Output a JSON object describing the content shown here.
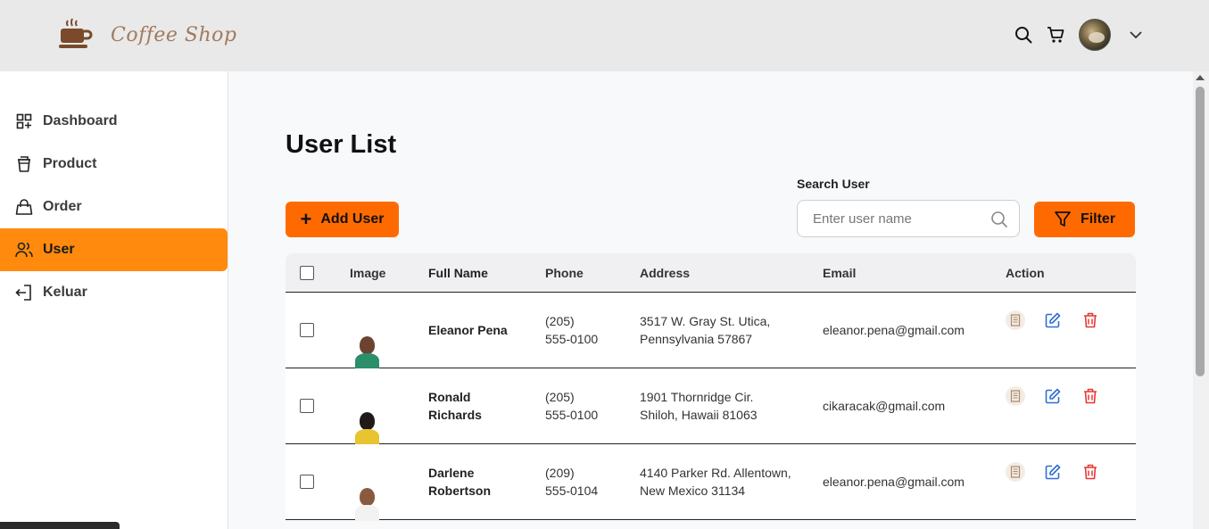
{
  "header": {
    "logo_text": "Coffee Shop",
    "icons": [
      "search-icon",
      "cart-icon",
      "avatar",
      "chevron-down-icon"
    ]
  },
  "sidebar": {
    "items": [
      {
        "label": "Dashboard",
        "icon": "dashboard-icon",
        "active": false
      },
      {
        "label": "Product",
        "icon": "cup-icon",
        "active": false
      },
      {
        "label": "Order",
        "icon": "bag-icon",
        "active": false
      },
      {
        "label": "User",
        "icon": "users-icon",
        "active": true
      },
      {
        "label": "Keluar",
        "icon": "logout-icon",
        "active": false
      }
    ]
  },
  "main": {
    "title": "User List",
    "add_button": "Add User",
    "search": {
      "label": "Search User",
      "placeholder": "Enter user name"
    },
    "filter_button": "Filter",
    "table": {
      "headers": [
        "Image",
        "Full Name",
        "Phone",
        "Address",
        "Email",
        "Action"
      ],
      "rows": [
        {
          "name": "Eleanor Pena",
          "phone": "(205) 555-0100",
          "address": "3517 W. Gray St. Utica, Pennsylvania 57867",
          "email": "eleanor.pena@gmail.com"
        },
        {
          "name": "Ronald Richards",
          "phone": "(205) 555-0100",
          "address": "1901 Thornridge Cir. Shiloh, Hawaii 81063",
          "email": "cikaracak@gmail.com"
        },
        {
          "name": "Darlene Robertson",
          "phone": "(209) 555-0104",
          "address": "4140 Parker Rd. Allentown, New Mexico 31134",
          "email": "eleanor.pena@gmail.com"
        }
      ]
    }
  },
  "colors": {
    "accent": "#ff8a0d",
    "button": "#ff6a00",
    "header_bg": "#e9e9e9",
    "logo": "#a27a5e",
    "edit": "#2f6fd6",
    "delete": "#e53935"
  }
}
